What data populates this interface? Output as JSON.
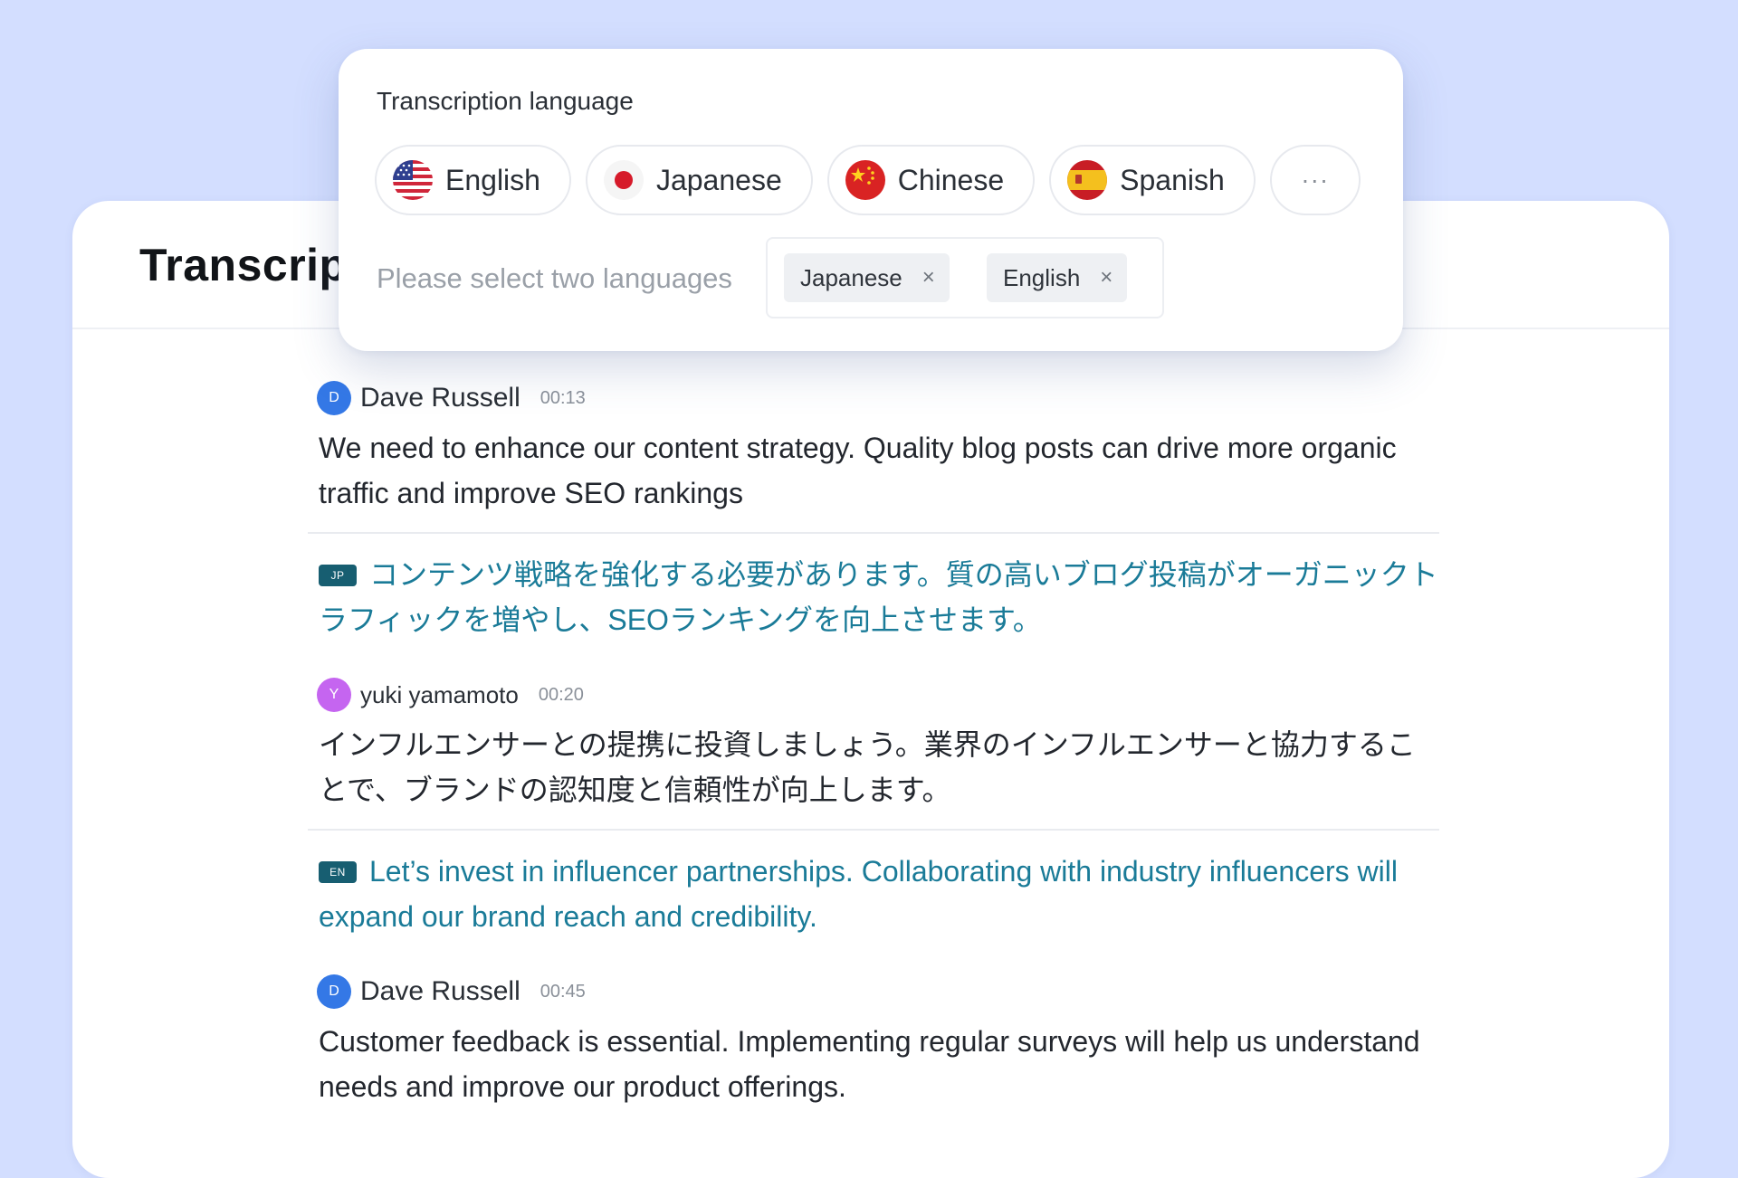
{
  "card": {
    "title": "Transcript"
  },
  "popover": {
    "title": "Transcription language",
    "languages": [
      {
        "label": "English",
        "flag": "us-flag-icon"
      },
      {
        "label": "Japanese",
        "flag": "japan-flag-icon"
      },
      {
        "label": "Chinese",
        "flag": "china-flag-icon"
      },
      {
        "label": "Spanish",
        "flag": "spain-flag-icon"
      }
    ],
    "more_label": "···",
    "hint": "Please select two languages",
    "selected": [
      {
        "label": "Japanese",
        "remove": "×"
      },
      {
        "label": "English",
        "remove": "×"
      }
    ]
  },
  "transcript": [
    {
      "avatar": "D",
      "avatar_color": "#3478e6",
      "speaker": "Dave Russell",
      "time": "00:13",
      "text": "We need to enhance our content strategy. Quality blog posts can drive more organic traffic and improve SEO rankings",
      "translation": {
        "tag": "JP",
        "text": "コンテンツ戦略を強化する必要があります。質の高いブログ投稿がオーガニックトラフィックを増やし、SEOランキングを向上させます。"
      }
    },
    {
      "avatar": "Y",
      "avatar_color": "#c565f0",
      "speaker": "yuki yamamoto",
      "time": "00:20",
      "text": "インフルエンサーとの提携に投資しましょう。業界のインフルエンサーと協力することで、ブランドの認知度と信頼性が向上します。",
      "translation": {
        "tag": "EN",
        "text": "Let’s invest in influencer partnerships. Collaborating with industry influencers will expand our brand reach and credibility."
      }
    },
    {
      "avatar": "D",
      "avatar_color": "#3478e6",
      "speaker": "Dave Russell",
      "time": "00:45",
      "text": "Customer feedback is essential. Implementing regular surveys will help us understand needs and improve our product offerings."
    }
  ],
  "colors": {
    "background": "#d3deff",
    "translation_text": "#1a7b98",
    "lang_tag": "#175e71"
  }
}
